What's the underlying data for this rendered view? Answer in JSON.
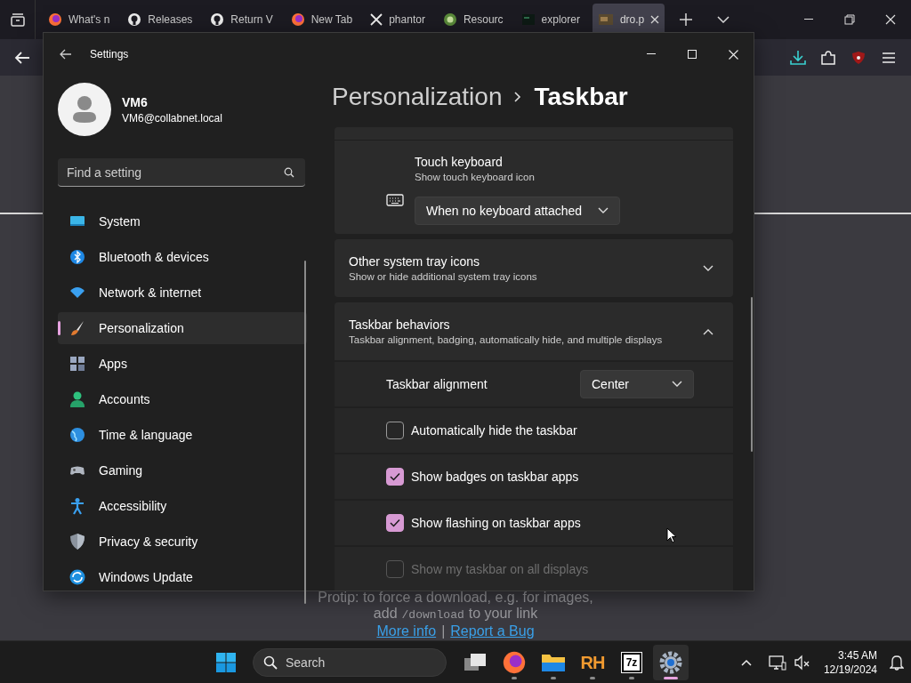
{
  "browser": {
    "tabs": [
      {
        "label": "What's n",
        "kind": "firefox",
        "selected": false
      },
      {
        "label": "Releases",
        "kind": "github",
        "selected": false
      },
      {
        "label": "Return V",
        "kind": "github",
        "selected": false
      },
      {
        "label": "New Tab",
        "kind": "firefox",
        "selected": false
      },
      {
        "label": "phantor",
        "kind": "x",
        "selected": false
      },
      {
        "label": "Resourc",
        "kind": "leaf",
        "selected": false
      },
      {
        "label": "explorer",
        "kind": "dark",
        "selected": false
      },
      {
        "label": "dro.p",
        "kind": "thumb",
        "selected": true
      }
    ],
    "page": {
      "protip": "Protip: to force a download, e.g. for images,",
      "add_before": "add",
      "add_code": "/download",
      "add_after": "to your link",
      "links": [
        "More info",
        "Report a Bug"
      ],
      "separator": "|"
    }
  },
  "settings": {
    "title": "Settings",
    "user": {
      "name": "VM6",
      "email": "VM6@collabnet.local"
    },
    "search": {
      "placeholder": "Find a setting"
    },
    "nav": [
      {
        "label": "System",
        "kind": "system",
        "selected": false
      },
      {
        "label": "Bluetooth & devices",
        "kind": "bluetooth",
        "selected": false
      },
      {
        "label": "Network & internet",
        "kind": "network",
        "selected": false
      },
      {
        "label": "Personalization",
        "kind": "brush",
        "selected": true
      },
      {
        "label": "Apps",
        "kind": "apps",
        "selected": false
      },
      {
        "label": "Accounts",
        "kind": "accounts",
        "selected": false
      },
      {
        "label": "Time & language",
        "kind": "globe",
        "selected": false
      },
      {
        "label": "Gaming",
        "kind": "gamepad",
        "selected": false
      },
      {
        "label": "Accessibility",
        "kind": "person",
        "selected": false
      },
      {
        "label": "Privacy & security",
        "kind": "shield",
        "selected": false
      },
      {
        "label": "Windows Update",
        "kind": "update",
        "selected": false
      }
    ],
    "breadcrumb": [
      "Personalization",
      "Taskbar"
    ],
    "touch_keyboard": {
      "title": "Touch keyboard",
      "description": "Show touch keyboard icon",
      "value": "When no keyboard attached"
    },
    "groups": [
      {
        "title": "Other system tray icons",
        "description": "Show or hide additional system tray icons",
        "expanded": false
      },
      {
        "title": "Taskbar behaviors",
        "description": "Taskbar alignment, badging, automatically hide, and multiple displays",
        "expanded": true,
        "rows": [
          {
            "kind": "dropdown",
            "label": "Taskbar alignment",
            "value": "Center"
          },
          {
            "kind": "checkbox",
            "label": "Automatically hide the taskbar",
            "checked": false,
            "disabled": false
          },
          {
            "kind": "checkbox",
            "label": "Show badges on taskbar apps",
            "checked": true,
            "disabled": false
          },
          {
            "kind": "checkbox",
            "label": "Show flashing on taskbar apps",
            "checked": true,
            "disabled": false
          },
          {
            "kind": "checkbox",
            "label": "Show my taskbar on all displays",
            "checked": false,
            "disabled": true
          }
        ]
      }
    ]
  },
  "taskbar": {
    "search": {
      "placeholder": "Search"
    },
    "apps": [
      {
        "kind": "taskview",
        "running": false,
        "active": false
      },
      {
        "kind": "firefox",
        "running": true,
        "active": false
      },
      {
        "kind": "folder",
        "running": true,
        "active": false
      },
      {
        "kind": "rh",
        "label": "RH",
        "running": true,
        "active": false
      },
      {
        "kind": "sevenzip",
        "label": "7z",
        "running": true,
        "active": false
      },
      {
        "kind": "gear",
        "running": true,
        "active": true
      }
    ],
    "time": "3:45 AM",
    "date": "12/19/2024"
  }
}
